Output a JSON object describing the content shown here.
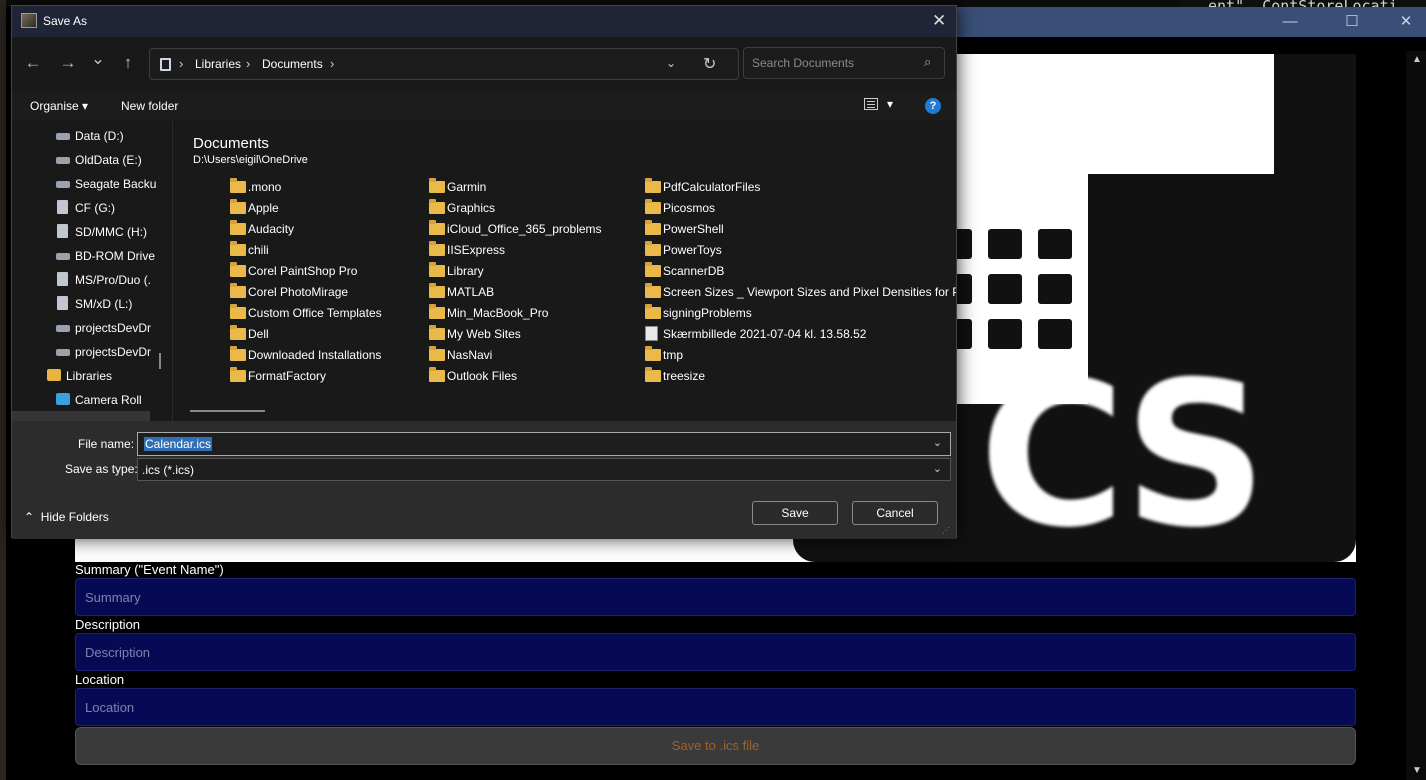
{
  "background_app": {
    "code_snippet": "ent\", ContStoreLocati",
    "window_controls": [
      "—",
      "☐",
      "✕"
    ],
    "form": {
      "summary_label": "Summary (\"Event Name\")",
      "summary_placeholder": "Summary",
      "description_label": "Description",
      "description_placeholder": "Description",
      "location_label": "Location",
      "location_placeholder": "Location",
      "save_button": "Save to .ics file"
    },
    "hero_text": "CS"
  },
  "dialog": {
    "title": "Save As",
    "close_glyph": "✕",
    "nav": {
      "back": "←",
      "forward": "→",
      "recent": "⌄",
      "up": "↑"
    },
    "breadcrumbs": [
      "Libraries",
      "Documents"
    ],
    "search_placeholder": "Search Documents",
    "commands": {
      "organise": "Organise ▾",
      "new_folder": "New folder",
      "view_dropdown": "▾",
      "help": "?"
    },
    "nav_pane": [
      {
        "label": "Data (D:)",
        "icon": "drive"
      },
      {
        "label": "OldData (E:)",
        "icon": "drive"
      },
      {
        "label": "Seagate Backu",
        "icon": "drive"
      },
      {
        "label": "CF (G:)",
        "icon": "disc"
      },
      {
        "label": "SD/MMC (H:)",
        "icon": "disc"
      },
      {
        "label": "BD-ROM Drive",
        "icon": "drive"
      },
      {
        "label": "MS/Pro/Duo (.",
        "icon": "disc"
      },
      {
        "label": "SM/xD (L:)",
        "icon": "disc"
      },
      {
        "label": "projectsDevDr",
        "icon": "drive"
      },
      {
        "label": "projectsDevDr",
        "icon": "drive"
      },
      {
        "label": "Libraries",
        "icon": "lib"
      },
      {
        "label": "Camera Roll",
        "icon": "cam"
      }
    ],
    "folder_title": "Documents",
    "folder_path": "D:\\Users\\eigil\\OneDrive",
    "files_col1": [
      ".mono",
      "Apple",
      "Audacity",
      "chili",
      "Corel PaintShop Pro",
      "Corel PhotoMirage",
      "Custom Office Templates",
      "Dell",
      "Downloaded Installations",
      "FormatFactory"
    ],
    "files_col2": [
      "Garmin",
      "Graphics",
      "iCloud_Office_365_problems",
      "IISExpress",
      "Library",
      "MATLAB",
      "Min_MacBook_Pro",
      "My Web Sites",
      "NasNavi",
      "Outlook Files"
    ],
    "files_col3": [
      "PdfCalculatorFiles",
      "Picosmos",
      "PowerShell",
      "PowerToys",
      "ScannerDB",
      "Screen Sizes _ Viewport Sizes and Pixel Densities for Popular",
      "signingProblems",
      "Skærmbillede 2021-07-04 kl. 13.58.52",
      "tmp",
      "treesize"
    ],
    "file_name_label": "File name:",
    "file_name_value": "Calendar.ics",
    "save_type_label": "Save as type:",
    "save_type_value": ".ics (*.ics)",
    "hide_folders": "Hide Folders",
    "save_button": "Save",
    "cancel_button": "Cancel"
  }
}
